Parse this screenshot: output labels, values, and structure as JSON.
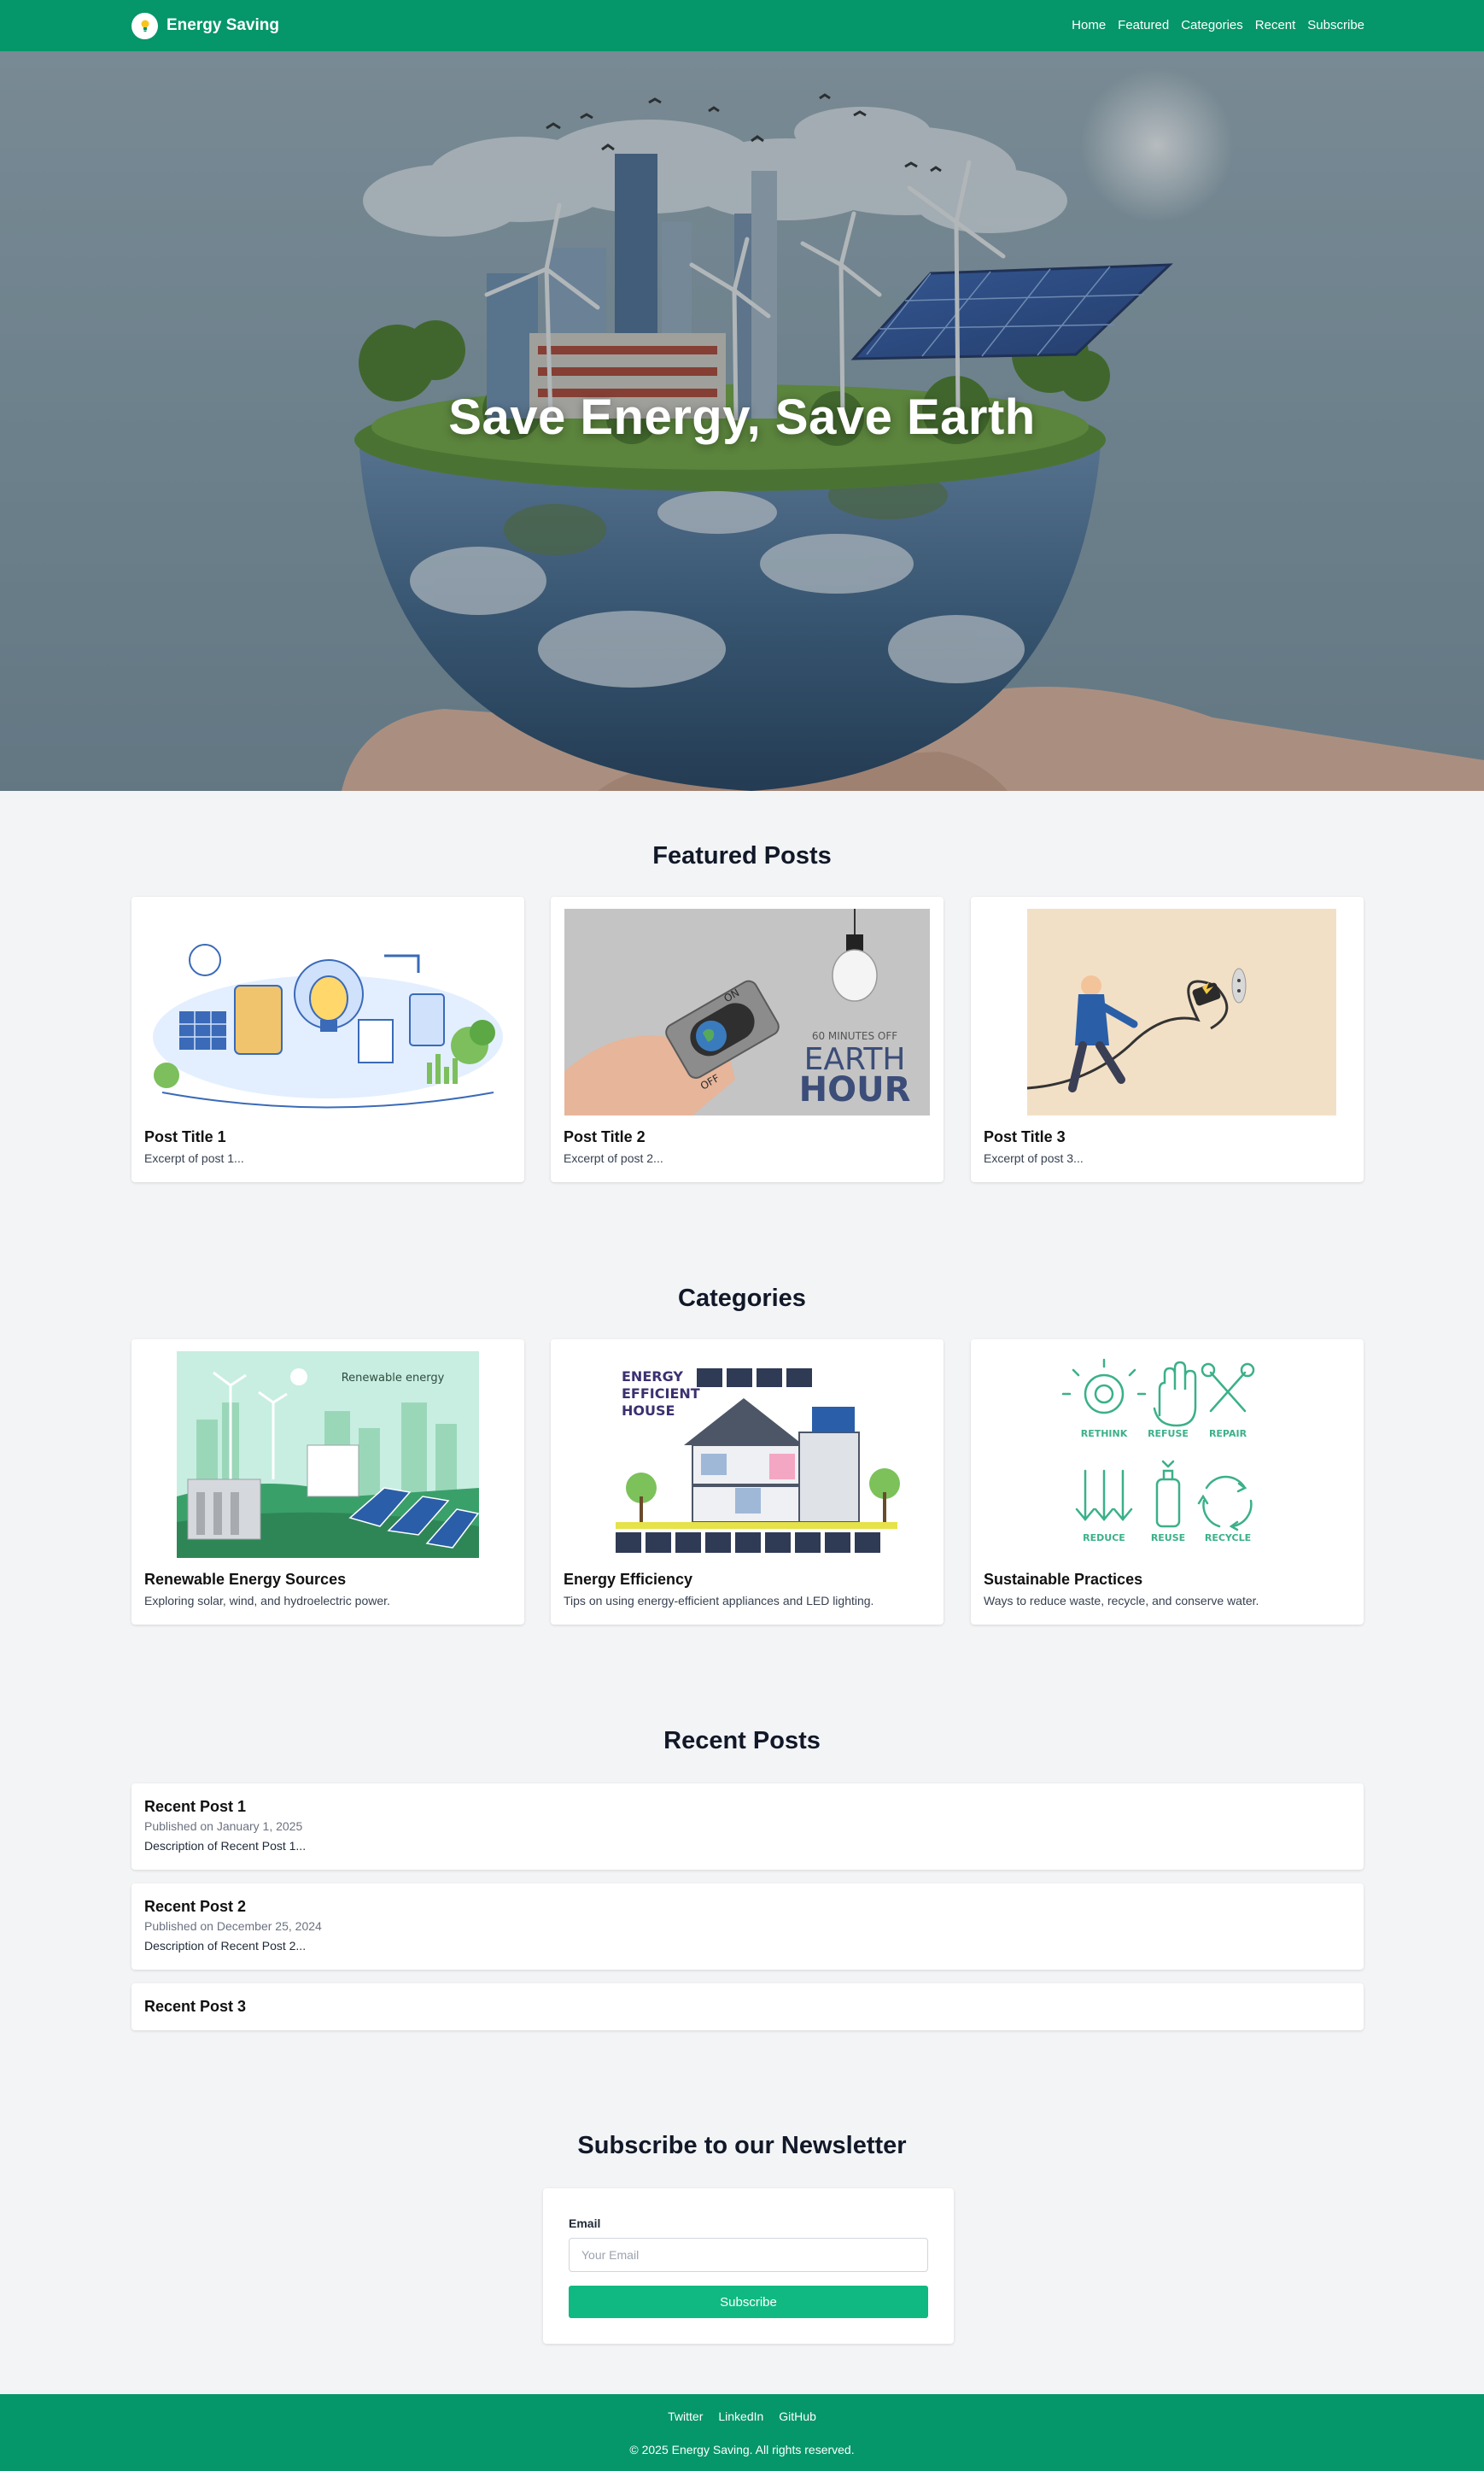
{
  "header": {
    "brand": "Energy Saving",
    "nav": [
      "Home",
      "Featured",
      "Categories",
      "Recent",
      "Subscribe"
    ]
  },
  "hero": {
    "title": "Save Energy, Save Earth"
  },
  "featured": {
    "title": "Featured Posts",
    "posts": [
      {
        "title": "Post Title 1",
        "excerpt": "Excerpt of post 1..."
      },
      {
        "title": "Post Title 2",
        "excerpt": "Excerpt of post 2..."
      },
      {
        "title": "Post Title 3",
        "excerpt": "Excerpt of post 3..."
      }
    ],
    "image_text": {
      "earth_hour_top": "60 MINUTES OFF",
      "earth_hour_1": "EARTH",
      "earth_hour_2": "HOUR",
      "switch_on": "ON",
      "switch_off": "OFF"
    }
  },
  "categories": {
    "title": "Categories",
    "items": [
      {
        "title": "Renewable Energy Sources",
        "desc": "Exploring solar, wind, and hydroelectric power."
      },
      {
        "title": "Energy Efficiency",
        "desc": "Tips on using energy-efficient appliances and LED lighting."
      },
      {
        "title": "Sustainable Practices",
        "desc": "Ways to reduce waste, recycle, and conserve water."
      }
    ],
    "image_text": {
      "renewable": "Renewable energy",
      "efficient_1": "ENERGY",
      "efficient_2": "EFFICIENT",
      "efficient_3": "HOUSE",
      "rs": [
        "RETHINK",
        "REFUSE",
        "REPAIR",
        "REDUCE",
        "REUSE",
        "RECYCLE"
      ]
    }
  },
  "recent": {
    "title": "Recent Posts",
    "posts": [
      {
        "title": "Recent Post 1",
        "date": "Published on January 1, 2025",
        "desc": "Description of Recent Post 1..."
      },
      {
        "title": "Recent Post 2",
        "date": "Published on December 25, 2024",
        "desc": "Description of Recent Post 2..."
      },
      {
        "title": "Recent Post 3"
      }
    ]
  },
  "newsletter": {
    "title": "Subscribe to our Newsletter",
    "email_label": "Email",
    "email_placeholder": "Your Email",
    "button": "Subscribe"
  },
  "footer": {
    "links": [
      "Twitter",
      "LinkedIn",
      "GitHub"
    ],
    "copyright": "© 2025 Energy Saving. All rights reserved."
  },
  "colors": {
    "brand": "#059669",
    "button": "#10b981",
    "page_bg": "#f3f4f6"
  }
}
